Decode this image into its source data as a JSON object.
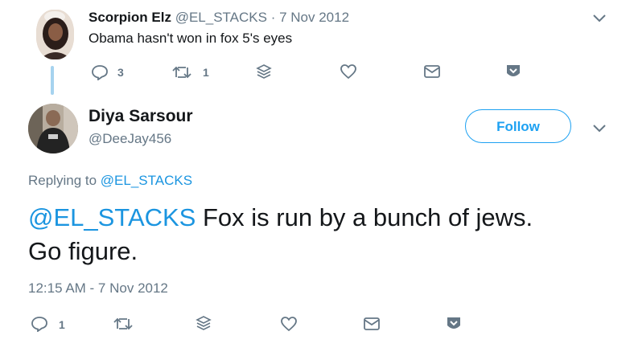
{
  "parent_tweet": {
    "name": "Scorpion Elz",
    "handle": "@EL_STACKS",
    "date": "· 7 Nov 2012",
    "text": "Obama hasn't won in fox 5's eyes",
    "reply_count": "3",
    "retweet_count": "1"
  },
  "main_tweet": {
    "name": "Diya Sarsour",
    "handle": "@DeeJay456",
    "follow_label": "Follow",
    "replying_prefix": "Replying to",
    "replying_handle": "@EL_STACKS",
    "text_mention": "@EL_STACKS",
    "text_body": "Fox is run by a bunch of jews.",
    "text_line2": "Go figure.",
    "timestamp": "12:15 AM - 7 Nov 2012",
    "reply_count": "1"
  },
  "icons": {
    "reply": "reply-icon",
    "retweet": "retweet-icon",
    "layers": "layers-icon",
    "like": "heart-icon",
    "message": "envelope-icon",
    "more": "chevron-box-icon",
    "caret": "chevron-down-icon"
  },
  "colors": {
    "accent": "#1da1f2",
    "link": "#1b95e0",
    "muted": "#657786",
    "thread_line": "#a6d3ef"
  }
}
